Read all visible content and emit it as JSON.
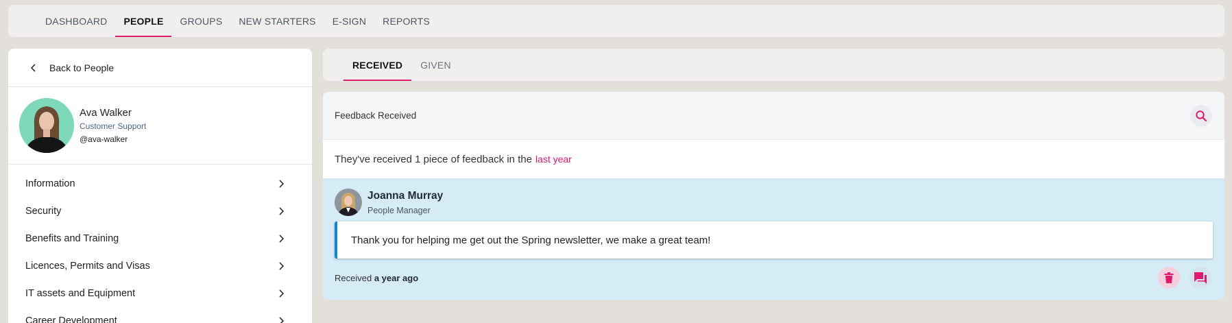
{
  "topnav": {
    "items": [
      {
        "label": "DASHBOARD",
        "active": false
      },
      {
        "label": "PEOPLE",
        "active": true
      },
      {
        "label": "GROUPS",
        "active": false
      },
      {
        "label": "NEW STARTERS",
        "active": false
      },
      {
        "label": "E-SIGN",
        "active": false
      },
      {
        "label": "REPORTS",
        "active": false
      }
    ]
  },
  "sidebar": {
    "back_label": "Back to People",
    "profile": {
      "name": "Ava Walker",
      "role": "Customer Support",
      "handle": "@ava-walker"
    },
    "menu": [
      {
        "label": "Information"
      },
      {
        "label": "Security"
      },
      {
        "label": "Benefits and Training"
      },
      {
        "label": "Licences, Permits and Visas"
      },
      {
        "label": "IT assets and Equipment"
      },
      {
        "label": "Career Development"
      }
    ]
  },
  "tabs": [
    {
      "label": "RECEIVED",
      "active": true
    },
    {
      "label": "GIVEN",
      "active": false
    }
  ],
  "feedback": {
    "header_title": "Feedback Received",
    "summary_text": "They've received 1 piece of feedback in the",
    "summary_link": "last year",
    "entry": {
      "giver_name": "Joanna Murray",
      "giver_role": "People Manager",
      "message": "Thank you for helping me get out the Spring newsletter, we make a great team!",
      "received_prefix": "Received",
      "received_when": "a year ago"
    }
  },
  "colors": {
    "accent": "#e0196e",
    "entry_background": "#d5ebf6",
    "message_border": "#0f86d8"
  }
}
